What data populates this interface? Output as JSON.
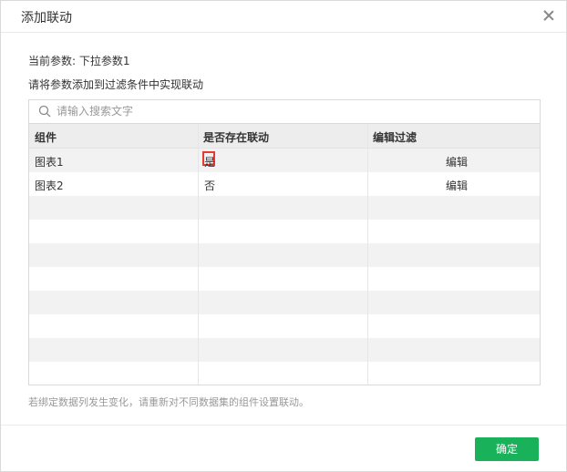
{
  "dialog": {
    "title": "添加联动",
    "current_param_line": "当前参数: 下拉参数1",
    "instruction": "请将参数添加到过滤条件中实现联动",
    "note": "若绑定数据列发生变化，请重新对不同数据集的组件设置联动。",
    "ok_label": "确定"
  },
  "search": {
    "placeholder": "请输入搜索文字",
    "value": ""
  },
  "table": {
    "headers": [
      "组件",
      "是否存在联动",
      "编辑过滤"
    ],
    "rows": [
      {
        "component": "图表1",
        "linked": "是",
        "action": "编辑"
      },
      {
        "component": "图表2",
        "linked": "否",
        "action": "编辑"
      }
    ]
  },
  "icons": {
    "search": "search-icon",
    "close": "close-icon"
  },
  "colors": {
    "primary_button": "#19b25b",
    "highlight": "#e53935"
  }
}
